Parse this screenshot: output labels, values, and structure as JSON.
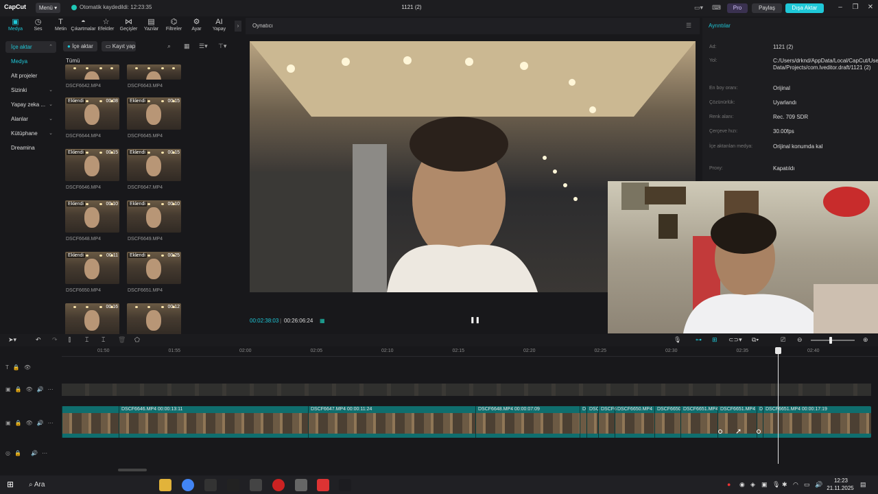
{
  "titlebar": {
    "logo": "CapCut",
    "menu": "Menü",
    "autosave": "Otomatik kaydedildi: 12:23:35",
    "project_title": "1121 (2)",
    "pro": "Pro",
    "share": "Paylaş",
    "export": "Dışa Aktar"
  },
  "tools": [
    {
      "label": "Medya",
      "icon": "media-icon"
    },
    {
      "label": "Ses",
      "icon": "audio-icon"
    },
    {
      "label": "Metin",
      "icon": "text-icon"
    },
    {
      "label": "Çıkartmalar",
      "icon": "sticker-icon"
    },
    {
      "label": "Efektler",
      "icon": "effects-icon"
    },
    {
      "label": "Geçişler",
      "icon": "transitions-icon"
    },
    {
      "label": "Yazılar",
      "icon": "captions-icon"
    },
    {
      "label": "Filtreler",
      "icon": "filters-icon"
    },
    {
      "label": "Ayar",
      "icon": "adjust-icon"
    },
    {
      "label": "Yapay",
      "icon": "ai-icon"
    }
  ],
  "left_nav": {
    "items": [
      {
        "label": "İçe aktar"
      },
      {
        "label": "Medya"
      },
      {
        "label": "Alt projeler"
      },
      {
        "label": "Sizinki"
      },
      {
        "label": "Yapay zeka ..."
      },
      {
        "label": "Alanlar"
      },
      {
        "label": "Kütüphane"
      },
      {
        "label": "Dreamina"
      }
    ]
  },
  "media": {
    "import": "İçe aktar",
    "record": "Kayıt yap",
    "filter_all": "Tümü",
    "items": [
      {
        "name": "DSCF6642.MP4",
        "badge": "",
        "duration": ""
      },
      {
        "name": "DSCF6643.MP4",
        "badge": "",
        "duration": ""
      },
      {
        "name": "DSCF6644.MP4",
        "badge": "Eklendi",
        "duration": "00:08"
      },
      {
        "name": "DSCF6645.MP4",
        "badge": "Eklendi",
        "duration": "00:15"
      },
      {
        "name": "DSCF6646.MP4",
        "badge": "Eklendi",
        "duration": "00:15"
      },
      {
        "name": "DSCF6647.MP4",
        "badge": "Eklendi",
        "duration": "00:15"
      },
      {
        "name": "DSCF6648.MP4",
        "badge": "Eklendi",
        "duration": "00:10"
      },
      {
        "name": "DSCF6649.MP4",
        "badge": "Eklendi",
        "duration": "00:10"
      },
      {
        "name": "DSCF6650.MP4",
        "badge": "Eklendi",
        "duration": "00:11"
      },
      {
        "name": "DSCF6651.MP4",
        "badge": "Eklendi",
        "duration": "00:25"
      },
      {
        "name": "",
        "badge": "",
        "duration": "00:16"
      },
      {
        "name": "",
        "badge": "",
        "duration": "00:12"
      }
    ]
  },
  "player": {
    "title": "Oynatıcı",
    "current_time": "00:02:38:03",
    "total_time": "00:26:06:24"
  },
  "details": {
    "title": "Ayrıntılar",
    "rows": [
      {
        "label": "Ad:",
        "value": "1121 (2)"
      },
      {
        "label": "Yol:",
        "value": "C:/Users/drknd/AppData/Local/CapCut/User Data/Projects/com.lveditor.draft/1121 (2)"
      },
      {
        "label": "En boy oranı:",
        "value": "Orijinal"
      },
      {
        "label": "Çözünürlük:",
        "value": "Uyarlandı"
      },
      {
        "label": "Renk alanı:",
        "value": "Rec. 709 SDR"
      },
      {
        "label": "Çerçeve hızı:",
        "value": "30.00fps"
      },
      {
        "label": "İçe aktarılan medya:",
        "value": "Orijinal konumda kal"
      },
      {
        "label": "Proxy:",
        "value": "Kapatıldı"
      }
    ]
  },
  "timeline": {
    "ticks": [
      "01:50",
      "01:55",
      "02:00",
      "02:05",
      "02:10",
      "02:15",
      "02:20",
      "02:25",
      "02:30",
      "02:35",
      "02:40"
    ],
    "clips": [
      {
        "label": ""
      },
      {
        "label": "DSCF6646.MP4  00:00:13:11"
      },
      {
        "label": "DSCF6647.MP4  00:00:11:24"
      },
      {
        "label": "DSCF6648.MP4  00:00:07:09"
      },
      {
        "label": "D"
      },
      {
        "label": "DSC"
      },
      {
        "label": "DSCF6"
      },
      {
        "label": "DSCF6650.MP4"
      },
      {
        "label": "DSCF6650"
      },
      {
        "label": "DSCF6651.MP4"
      },
      {
        "label": "DSCF6651.MP4"
      },
      {
        "label": "D"
      },
      {
        "label": "DSCF6651.MP4  00:00:17:19"
      }
    ]
  },
  "taskbar": {
    "search": "Ara",
    "time": "12:23",
    "date": "21.11.2025"
  }
}
